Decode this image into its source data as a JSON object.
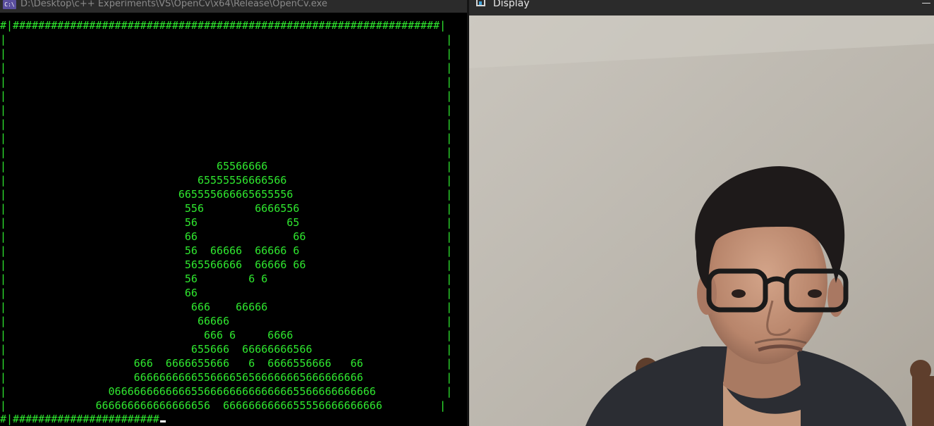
{
  "console": {
    "title": "D:\\Desktop\\c++ Experiments\\VS\\OpenCv\\x64\\Release\\OpenCv.exe",
    "icon": "console-app-icon",
    "icon_text": "C:\\",
    "text_color": "#2fe82f",
    "lines": [
      "#|###################################################################|",
      "|                                                                     |",
      "|                                                                     |",
      "|                                                                     |",
      "|                                                                     |",
      "|                                                                     |",
      "|                                                                     |",
      "|                                                                     |",
      "|                                                                     |",
      "|                                                                     |",
      "|                                 65566666                            |",
      "|                              65555556666566                         |",
      "|                           665555666665655556                        |",
      "|                            556        6666556                       |",
      "|                            56              65                       |",
      "|                            66               66                      |",
      "|                            56  66666  66666 6                       |",
      "|                            565566666  66666 66                      |",
      "|                            56        6 6                            |",
      "|                            66                                       |",
      "|                             666    66666                            |",
      "|                              66666                                  |",
      "|                               666 6     6666                        |",
      "|                             655666  66666666566                     |",
      "|                    666  6666655666   6  6666556666   66             |",
      "|                    666666666655666656566666665666666666             |",
      "|                066666666666655666666666666665566666666666           |",
      "|              666666666666666656  6666666666655556666666666         |",
      "#|#######################"
    ]
  },
  "display": {
    "title": "Display",
    "icon": "display-window-icon",
    "minimize_label": "—"
  }
}
